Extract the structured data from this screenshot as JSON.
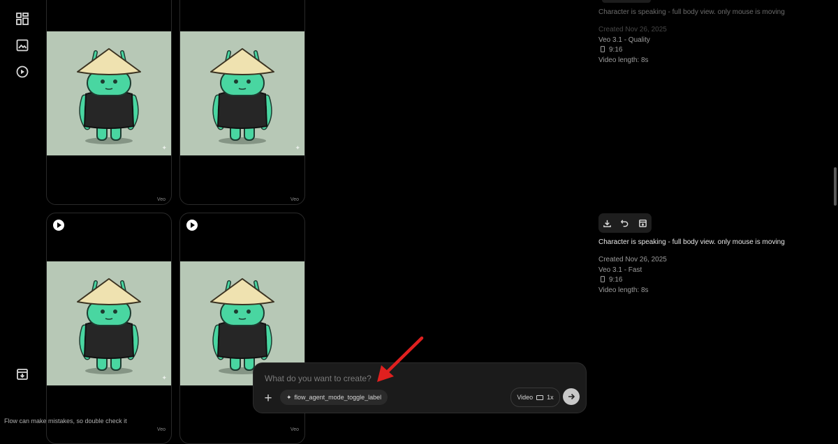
{
  "rail": {
    "items": [
      {
        "name": "grid-icon"
      },
      {
        "name": "image-icon"
      },
      {
        "name": "play-circle-icon"
      }
    ],
    "bottom": {
      "name": "download-box-icon"
    }
  },
  "cards": {
    "watermark": "Veo"
  },
  "panel": {
    "previous": {
      "title": "Character is speaking - full body view. only mouse is moving",
      "created": "Created Nov 26, 2025",
      "model": "Veo 3.1 - Quality",
      "aspect": "9:16",
      "length": "Video length: 8s"
    },
    "current": {
      "title": "Character is speaking - full body view. only mouse is moving",
      "created": "Created Nov 26, 2025",
      "model": "Veo 3.1 - Fast",
      "aspect": "9:16",
      "length": "Video length: 8s"
    },
    "actions": [
      "download-icon",
      "undo-icon",
      "save-to-collection-icon"
    ]
  },
  "composer": {
    "placeholder": "What do you want to create?",
    "plus": "+",
    "agent_label": "flow_agent_mode_toggle_label",
    "mode_label": "Video",
    "count_label": "1x"
  },
  "footer": {
    "disclaimer": "Flow can make mistakes, so double check it"
  },
  "colors": {
    "background": "#000000",
    "annotation_arrow": "#e0201f",
    "thumbnail_bg": "#b7c8b6"
  }
}
